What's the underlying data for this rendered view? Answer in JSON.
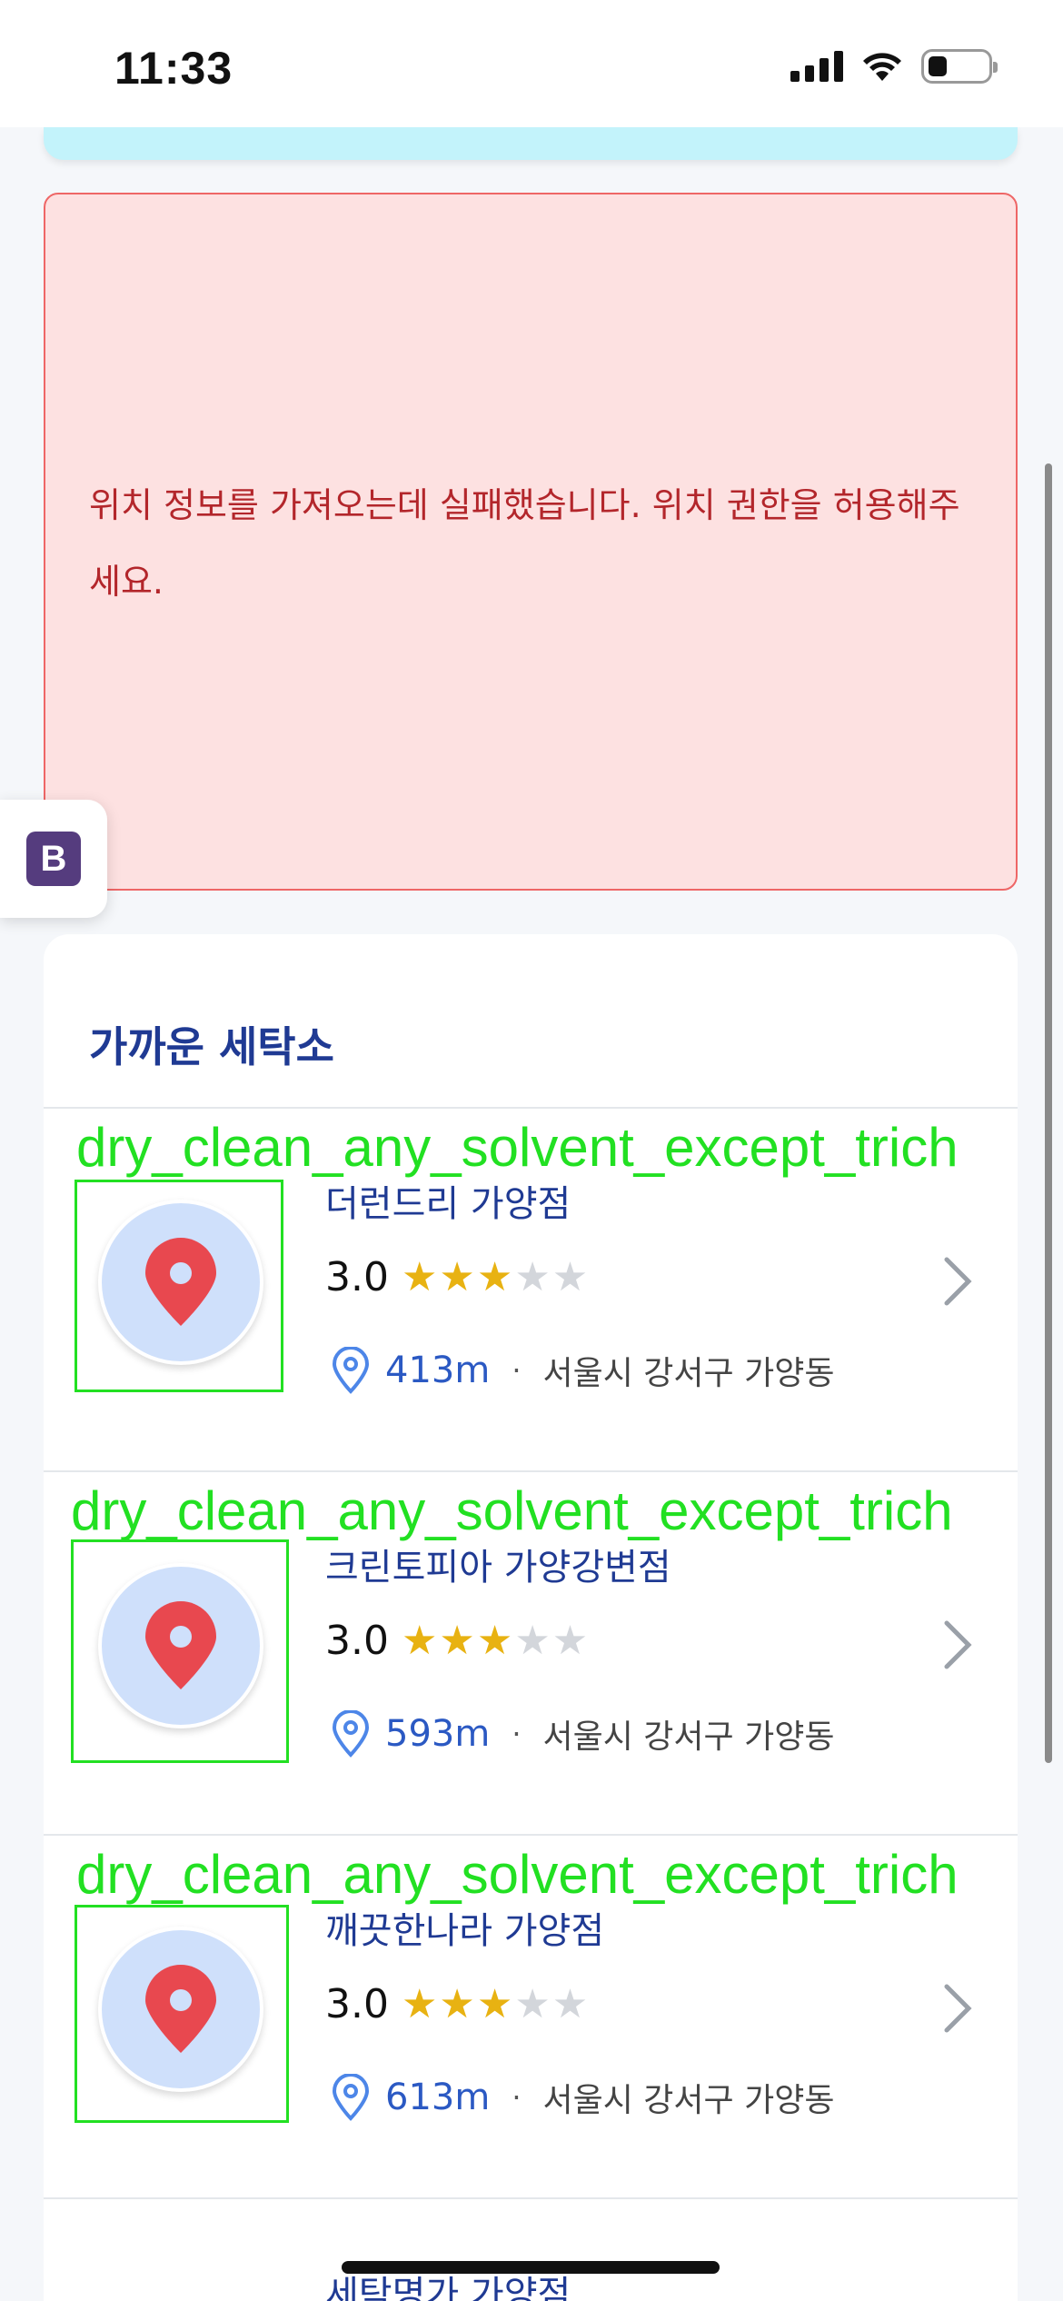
{
  "status_bar": {
    "time": "11:33"
  },
  "error": {
    "message": "위치 정보를 가져오는데 실패했습니다. 위치 권한을 허용해주세요."
  },
  "floating_button": {
    "label": "B",
    "color": "#553c7e"
  },
  "nearby": {
    "title": "가까운 세탁소",
    "overlay_label": "dry_clean_any_solvent_except_trich",
    "shops": [
      {
        "name": "더런드리 가양점",
        "rating": "3.0",
        "stars_filled": 3,
        "stars_total": 5,
        "distance": "413m",
        "separator": "·",
        "address": "서울시 강서구 가양동"
      },
      {
        "name": "크린토피아 가양강변점",
        "rating": "3.0",
        "stars_filled": 3,
        "stars_total": 5,
        "distance": "593m",
        "separator": "·",
        "address": "서울시 강서구 가양동"
      },
      {
        "name": "깨끗한나라 가양점",
        "rating": "3.0",
        "stars_filled": 3,
        "stars_total": 5,
        "distance": "613m",
        "separator": "·",
        "address": "서울시 강서구 가양동"
      },
      {
        "name": "세탁명가 가양점"
      }
    ]
  },
  "colors": {
    "accent": "#1f3a93",
    "error_bg": "#fde1e1",
    "error_text": "#b3262b",
    "star": "#e8b212",
    "pin": "#e8484f",
    "overlay": "#22e022"
  }
}
